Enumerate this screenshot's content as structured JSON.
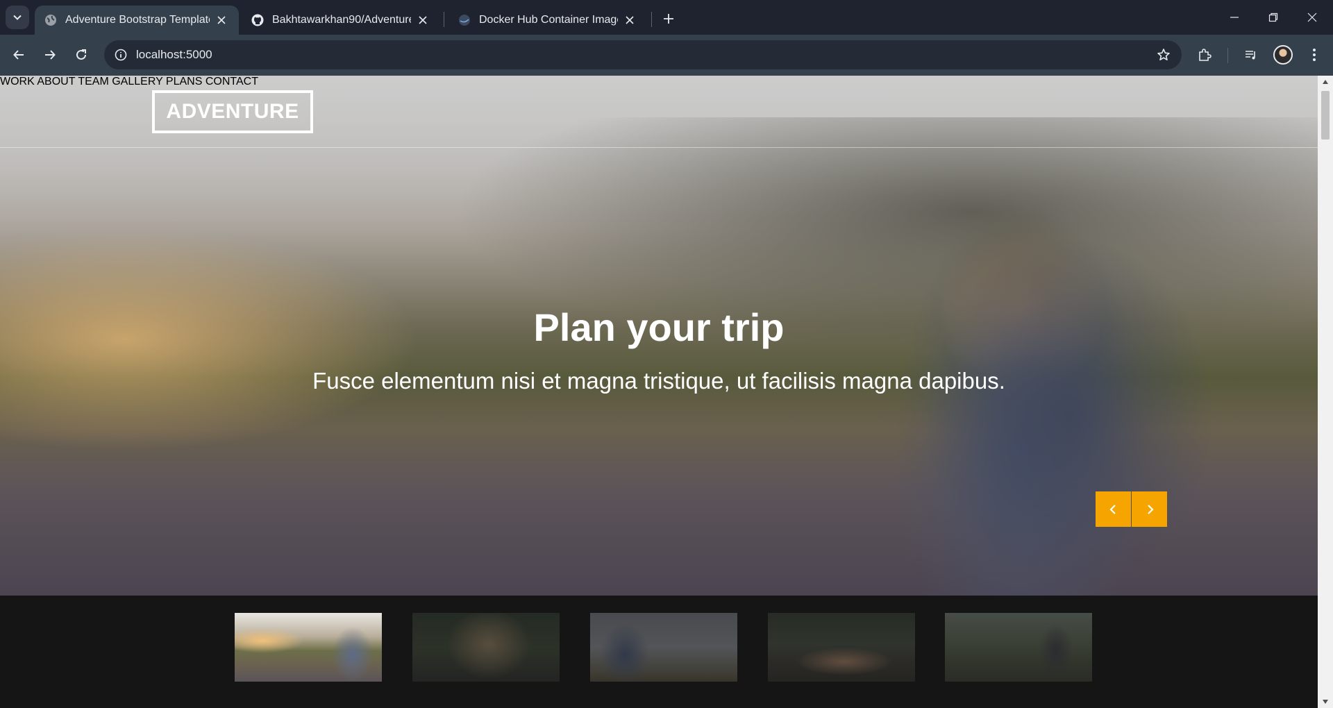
{
  "browser": {
    "tabs": [
      {
        "title": "Adventure Bootstrap Template",
        "active": true,
        "icon": "globe-icon"
      },
      {
        "title": "Bakhtawarkhan90/Adventure: T",
        "active": false,
        "icon": "github-icon"
      },
      {
        "title": "Docker Hub Container Image Li",
        "active": false,
        "icon": "docker-icon"
      }
    ],
    "address": "localhost:5000"
  },
  "page": {
    "logo": "ADVENTURE",
    "nav": [
      "WORK",
      "ABOUT",
      "TEAM",
      "GALLERY",
      "PLANS",
      "CONTACT"
    ],
    "hero": {
      "title": "Plan your trip",
      "subtitle": "Fusce elementum nisi et magna tristique, ut facilisis magna dapibus."
    },
    "accent_color": "#f6a400",
    "thumbnails": [
      {
        "name": "woman-bicycle",
        "active": true
      },
      {
        "name": "woman-hair-forest",
        "active": false
      },
      {
        "name": "hooded-photographer",
        "active": false
      },
      {
        "name": "mountain-village",
        "active": false
      },
      {
        "name": "hiker-forest",
        "active": false
      }
    ]
  }
}
